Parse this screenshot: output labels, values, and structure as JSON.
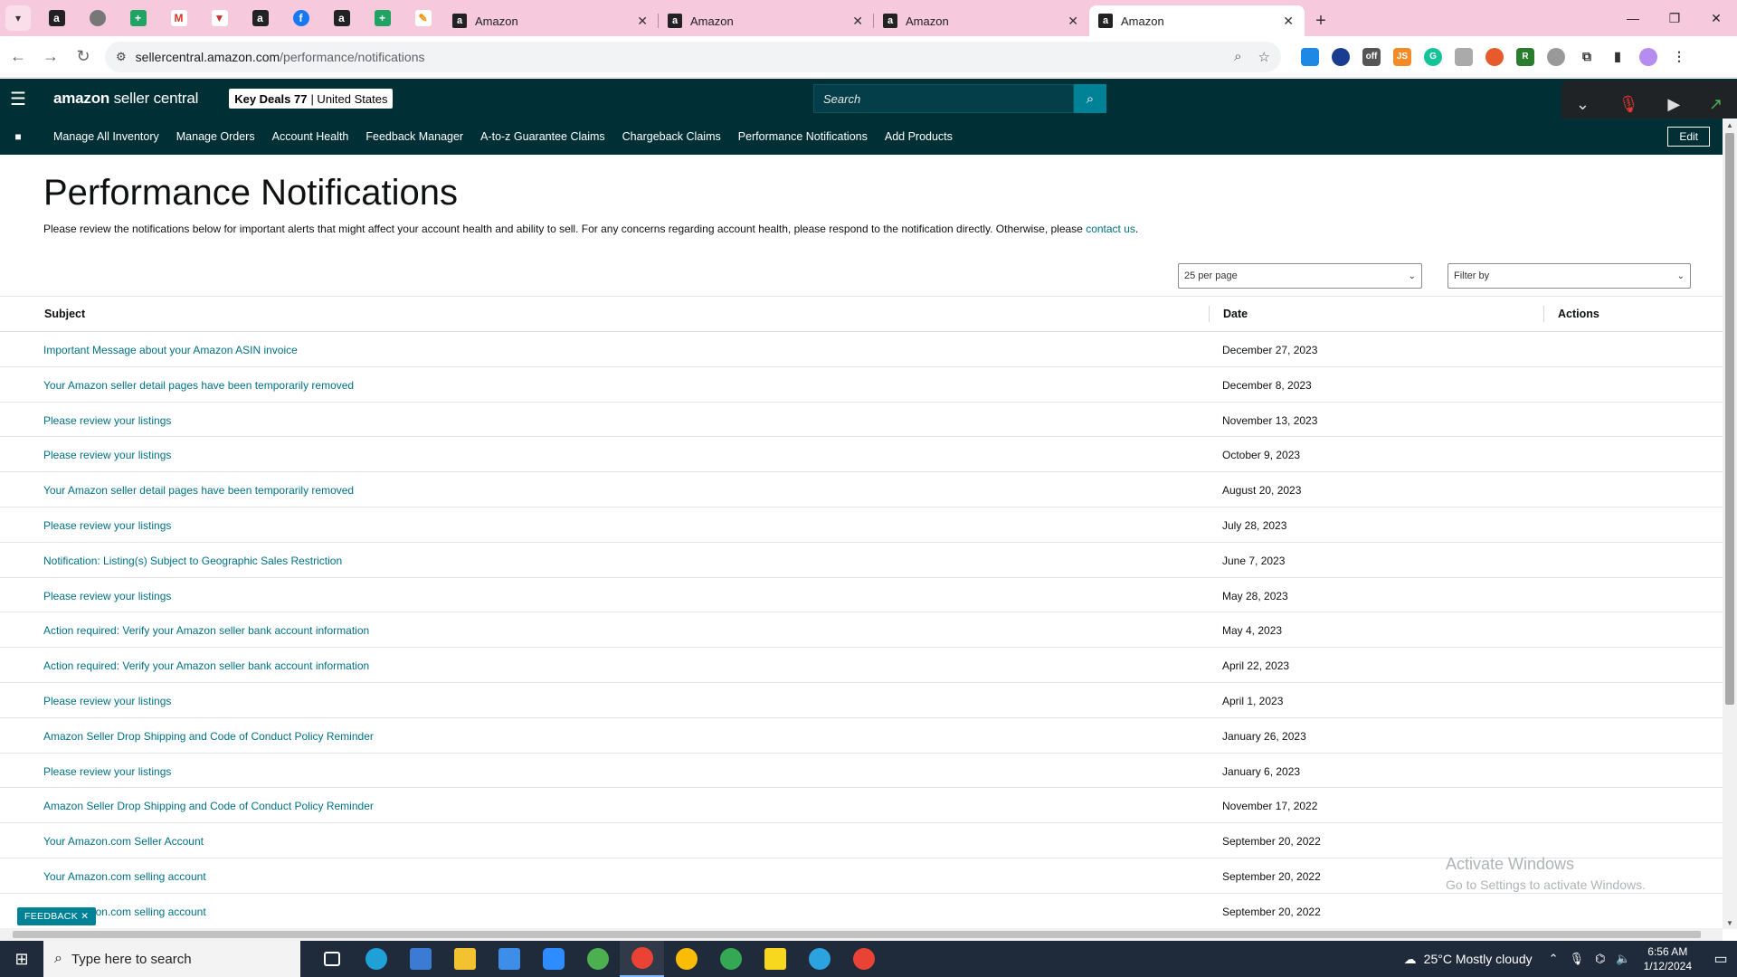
{
  "browser": {
    "tabs": [
      {
        "title": "Amazon"
      },
      {
        "title": "Amazon"
      },
      {
        "title": "Amazon"
      },
      {
        "title": "Amazon"
      }
    ],
    "url_host": "sellercentral.amazon.com",
    "url_path": "/performance/notifications"
  },
  "header": {
    "logo_bold": "amazon",
    "logo_rest": " seller central",
    "store_name": "Key Deals 77",
    "store_region": "| United States",
    "search_placeholder": "Search"
  },
  "nav": {
    "links": [
      "Manage All Inventory",
      "Manage Orders",
      "Account Health",
      "Feedback Manager",
      "A-to-z Guarantee Claims",
      "Chargeback Claims",
      "Performance Notifications",
      "Add Products"
    ],
    "edit_label": "Edit"
  },
  "page": {
    "title": "Performance Notifications",
    "intro_text": "Please review the notifications below for important alerts that might affect your account health and ability to sell. For any concerns regarding account health, please respond to the notification directly. Otherwise, please ",
    "intro_link": "contact us",
    "intro_end": ".",
    "per_page": "25 per page",
    "filter_placeholder": "Filter by"
  },
  "table": {
    "headers": {
      "subject": "Subject",
      "date": "Date",
      "actions": "Actions"
    },
    "rows": [
      {
        "subject": "Important Message about your Amazon ASIN invoice",
        "date": "December 27, 2023"
      },
      {
        "subject": "Your Amazon seller detail pages have been temporarily removed",
        "date": "December 8, 2023"
      },
      {
        "subject": "Please review your listings",
        "date": "November 13, 2023"
      },
      {
        "subject": "Please review your listings",
        "date": "October 9, 2023"
      },
      {
        "subject": "Your Amazon seller detail pages have been temporarily removed",
        "date": "August 20, 2023"
      },
      {
        "subject": "Please review your listings",
        "date": "July 28, 2023"
      },
      {
        "subject": "Notification: Listing(s) Subject to Geographic Sales Restriction",
        "date": "June 7, 2023"
      },
      {
        "subject": "Please review your listings",
        "date": "May 28, 2023"
      },
      {
        "subject": "Action required: Verify your Amazon seller bank account information",
        "date": "May 4, 2023"
      },
      {
        "subject": "Action required: Verify your Amazon seller bank account information",
        "date": "April 22, 2023"
      },
      {
        "subject": "Please review your listings",
        "date": "April 1, 2023"
      },
      {
        "subject": "Amazon Seller Drop Shipping and Code of Conduct Policy Reminder",
        "date": "January 26, 2023"
      },
      {
        "subject": "Please review your listings",
        "date": "January 6, 2023"
      },
      {
        "subject": "Amazon Seller Drop Shipping and Code of Conduct Policy Reminder",
        "date": "November 17, 2022"
      },
      {
        "subject": "Your Amazon.com Seller Account",
        "date": "September 20, 2022"
      },
      {
        "subject": "Your Amazon.com selling account",
        "date": "September 20, 2022"
      },
      {
        "subject": "Your Amazon.com selling account",
        "date": "September 20, 2022"
      }
    ]
  },
  "overlay": {
    "activate_title": "Activate Windows",
    "activate_sub": "Go to Settings to activate Windows.",
    "feedback_label": "FEEDBACK"
  },
  "taskbar": {
    "search_placeholder": "Type here to search",
    "weather": "25°C  Mostly cloudy",
    "time": "6:56 AM",
    "date": "1/12/2024"
  },
  "colors": {
    "header_bg": "#002f36",
    "link": "#007185",
    "tabstrip_bg": "#f7c9dc",
    "search_button": "#008296"
  }
}
